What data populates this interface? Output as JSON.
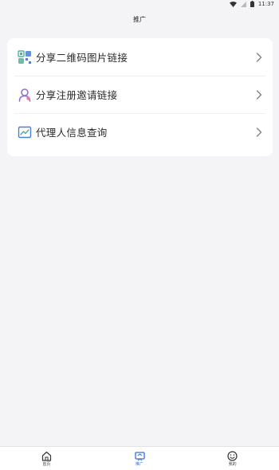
{
  "status_bar": {
    "time": "11:37"
  },
  "header": {
    "title": "推广"
  },
  "menu": [
    {
      "label": "分享二维码图片链接",
      "icon": "qrcode-icon"
    },
    {
      "label": "分享注册邀请链接",
      "icon": "user-icon"
    },
    {
      "label": "代理人信息查询",
      "icon": "chart-icon"
    }
  ],
  "tabbar": {
    "items": [
      {
        "label": "首页",
        "icon": "home-icon"
      },
      {
        "label": "推广",
        "icon": "promote-icon",
        "active": true
      },
      {
        "label": "我的",
        "icon": "smile-icon"
      }
    ]
  },
  "colors": {
    "accent": "#3a6fd8",
    "qr_green": "#4fb29a",
    "qr_blue": "#4b7fd6",
    "user_purple": "#8f6fd0",
    "background": "#f4f4f6"
  }
}
